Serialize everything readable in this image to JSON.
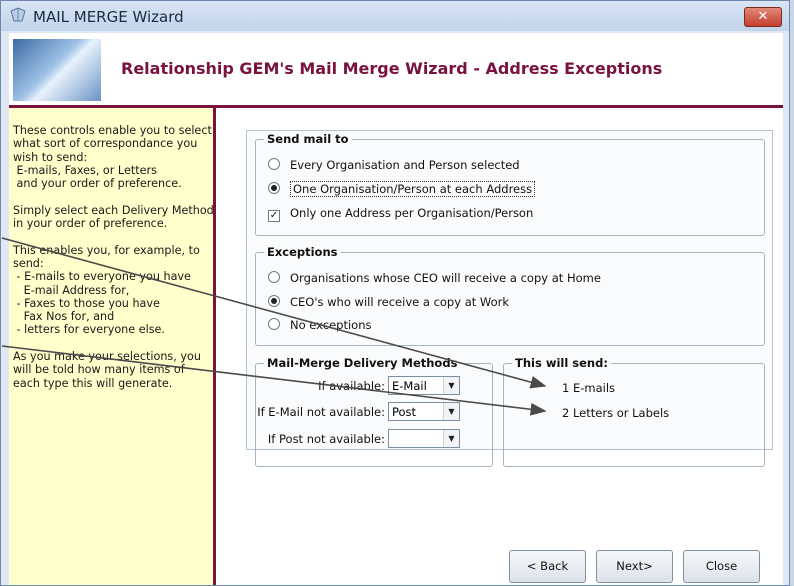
{
  "window": {
    "title": "MAIL MERGE Wizard",
    "close_label": "✕"
  },
  "header": {
    "title": "Relationship GEM's Mail Merge Wizard - Address Exceptions"
  },
  "sidebar": {
    "text": "These controls enable you to select\nwhat sort of correspondance you\nwish to send:\n E-mails, Faxes, or Letters\n and your order of preference.\n\nSimply select each Delivery Method\nin your order of preference.\n\nThis enables you, for example, to\nsend:\n - E-mails to everyone you have\n   E-mail Address for,\n - Faxes to those you have\n   Fax Nos for, and\n - letters for everyone else.\n\nAs you make your selections, you\nwill be told how many items of\neach type this will generate."
  },
  "send_mail_to": {
    "title": "Send mail to",
    "options": [
      {
        "label": "Every Organisation and Person selected",
        "selected": false
      },
      {
        "label": "One Organisation/Person at each Address",
        "selected": true
      }
    ],
    "checkbox": {
      "label": "Only one Address per Organisation/Person",
      "checked": true
    }
  },
  "exceptions": {
    "title": "Exceptions",
    "options": [
      {
        "label": "Organisations whose CEO will receive a copy at Home",
        "selected": false
      },
      {
        "label": "CEO's who will receive a copy at Work",
        "selected": true
      },
      {
        "label": "No exceptions",
        "selected": false
      }
    ]
  },
  "delivery": {
    "title": "Mail-Merge Delivery Methods",
    "fields": [
      {
        "label": "If available:",
        "value": "E-Mail"
      },
      {
        "label": "If E-Mail not available:",
        "value": "Post"
      },
      {
        "label": "If Post not available:",
        "value": ""
      }
    ]
  },
  "will_send": {
    "title": "This will send:",
    "lines": [
      "1 E-mails",
      "2 Letters or Labels"
    ]
  },
  "buttons": {
    "back": "< Back",
    "next": "Next>",
    "close": "Close"
  }
}
